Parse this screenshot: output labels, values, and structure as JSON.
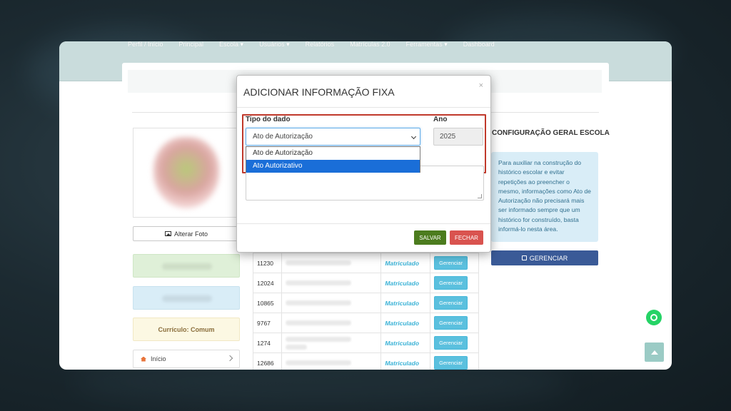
{
  "nav": {
    "items": [
      "Perfil / Início",
      "Principal",
      "Escola ▾",
      "Usuários ▾",
      "Relatórios",
      "Matrículas 2.0",
      "Ferramentas ▾",
      "Dashboard"
    ]
  },
  "left": {
    "photo_button": "Alterar Foto",
    "curriculo": "Currículo: Comum",
    "inicio": "Início"
  },
  "table": {
    "rows": [
      {
        "id": "11230",
        "status": "Matriculado",
        "action": "Gerenciar"
      },
      {
        "id": "12024",
        "status": "Matriculado",
        "action": "Gerenciar"
      },
      {
        "id": "10865",
        "status": "Matriculado",
        "action": "Gerenciar"
      },
      {
        "id": "9767",
        "status": "Matriculado",
        "action": "Gerenciar"
      },
      {
        "id": "1274",
        "status": "Matriculado",
        "action": "Gerenciar"
      },
      {
        "id": "12686",
        "status": "Matriculado",
        "action": "Gerenciar"
      }
    ]
  },
  "right": {
    "title": "CONFIGURAÇÃO GERAL ESCOLA",
    "info": "Para auxiliar na construção do histórico escolar e evitar repetições ao preencher o mesmo, informações como Ato de Autorização não precisará mais ser informado sempre que um histórico for construído, basta informá-lo nesta área.",
    "button": "GERENCIAR"
  },
  "modal": {
    "title": "ADICIONAR INFORMAÇÃO FIXA",
    "close": "×",
    "tipo_label": "Tipo do dado",
    "ano_label": "Ano",
    "select_value": "Ato de Autorização",
    "ano_value": "2025",
    "options": [
      "Ato de Autorização",
      "Ato Autorizativo"
    ],
    "highlighted_option_index": 1,
    "save": "SALVAR",
    "close_button": "FECHAR"
  },
  "colors": {
    "nav_bg": "#c9dcdc",
    "highlight_border": "#c0392b",
    "save": "#4c7c1e",
    "close": "#d9534f",
    "selected_option": "#1a6ed8",
    "status_text": "#3ab2d6"
  },
  "icons": [
    "picture-icon",
    "home-icon",
    "chevron-right-icon",
    "edit-icon",
    "whatsapp-icon",
    "arrow-up-icon",
    "chevron-down-icon",
    "close-icon"
  ]
}
